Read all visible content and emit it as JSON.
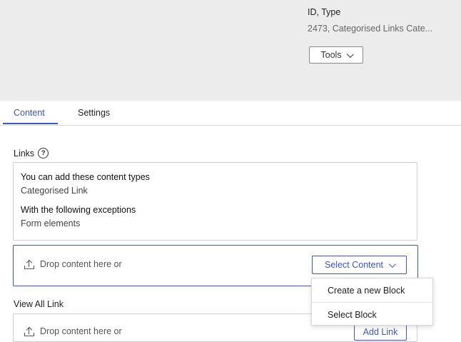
{
  "header": {
    "meta_label": "ID, Type",
    "meta_value": "2473, Categorised Links Cate...",
    "tools_label": "Tools"
  },
  "tabs": [
    {
      "label": "Content",
      "active": true
    },
    {
      "label": "Settings",
      "active": false
    }
  ],
  "links_section": {
    "label": "Links",
    "allowed_heading": "You can add these content types",
    "allowed_types": "Categorised Link",
    "exceptions_heading": "With the following exceptions",
    "exceptions": "Form elements",
    "drop_text": "Drop content here or",
    "select_button": "Select Content"
  },
  "view_all_section": {
    "label": "View All Link",
    "drop_text": "Drop content here or",
    "add_button": "Add Link"
  },
  "dropdown": {
    "items": [
      {
        "label": "Create a new Block"
      },
      {
        "label": "Select Block"
      }
    ]
  },
  "colors": {
    "accent": "#3a54d6",
    "header_bg": "#ececec"
  }
}
